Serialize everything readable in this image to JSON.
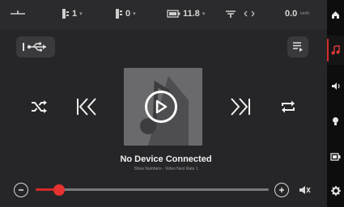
{
  "statusbar": {
    "item1": {
      "icon": "antenna-icon",
      "value": ""
    },
    "item2": {
      "icon": "gear-indicator-icon",
      "value": "1"
    },
    "item3": {
      "icon": "temperature-icon",
      "value": "0"
    },
    "item4": {
      "icon": "battery-icon",
      "value": "11.8"
    },
    "item5": {
      "icon": "wifi-icon",
      "value": ""
    },
    "item6": {
      "value": "0.0",
      "unit": "km/h"
    }
  },
  "media": {
    "title": "No Device Connected",
    "subtitle": "Show Numbers - Video Next Rate 1",
    "source_icon": "usb-icon",
    "menu_icon": "playlist-icon"
  },
  "volume": {
    "level": 0.1
  },
  "nav": {
    "items": [
      "home",
      "music",
      "volume",
      "light",
      "battery",
      "settings"
    ],
    "active": "music"
  },
  "colors": {
    "accent": "#d52a2a",
    "background": "#262628",
    "rail": "#0d0d0e"
  }
}
